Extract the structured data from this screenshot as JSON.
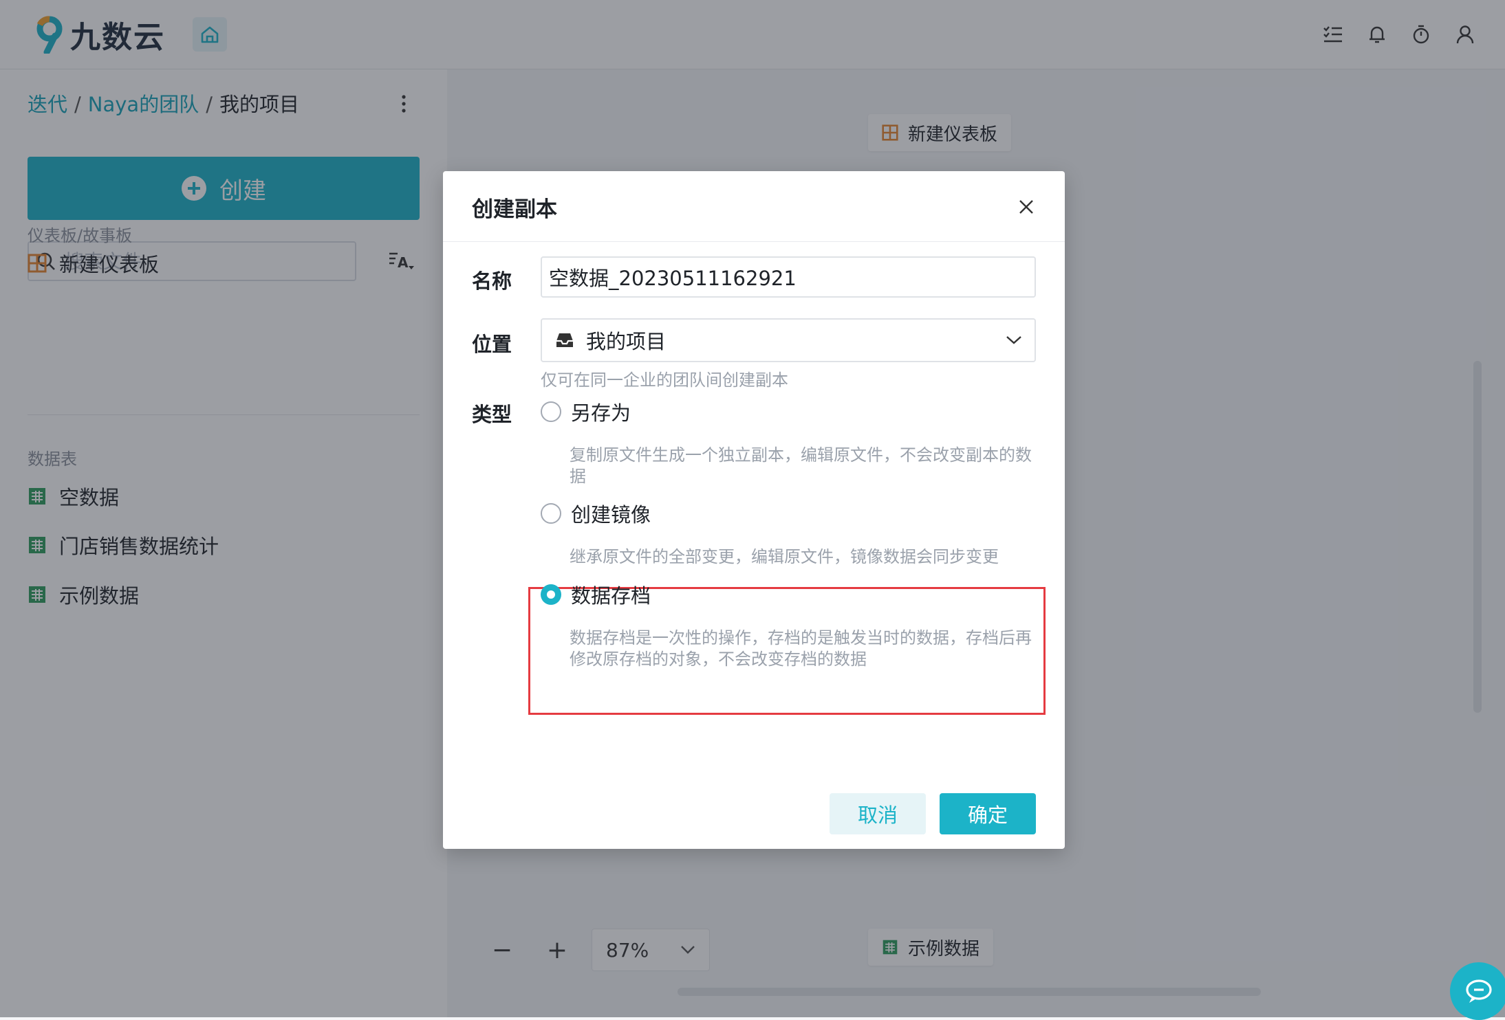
{
  "app": {
    "logo_text": "九数云"
  },
  "breadcrumb": {
    "items": [
      "迭代",
      "Naya的团队",
      "我的项目"
    ],
    "separator": "/"
  },
  "sidebar": {
    "create_label": "创建",
    "search_placeholder": "搜索文件",
    "dashboard_section": "仪表板/故事板",
    "dashboards": [
      "新建仪表板"
    ],
    "table_section": "数据表",
    "tables": [
      "空数据",
      "门店销售数据统计",
      "示例数据"
    ]
  },
  "canvas": {
    "chip_dashboard": "新建仪表板",
    "chip_table": "示例数据",
    "zoom": {
      "minus": "−",
      "plus": "+",
      "value": "87%"
    }
  },
  "modal": {
    "title": "创建副本",
    "name_label": "名称",
    "name_value": "空数据_20230511162921",
    "location_label": "位置",
    "location_value": "我的项目",
    "location_hint": "仅可在同一企业的团队间创建副本",
    "type_label": "类型",
    "options": [
      {
        "label": "另存为",
        "desc": "复制原文件生成一个独立副本，编辑原文件，不会改变副本的数据",
        "selected": false
      },
      {
        "label": "创建镜像",
        "desc": "继承原文件的全部变更，编辑原文件，镜像数据会同步变更",
        "selected": false
      },
      {
        "label": "数据存档",
        "desc": "数据存档是一次性的操作，存档的是触发当时的数据，存档后再修改原存档的对象，不会改变存档的数据",
        "selected": true
      }
    ],
    "cancel_label": "取消",
    "ok_label": "确定"
  },
  "colors": {
    "accent": "#1cb3c8",
    "highlight": "#e53b41",
    "link": "#17a2b8"
  }
}
